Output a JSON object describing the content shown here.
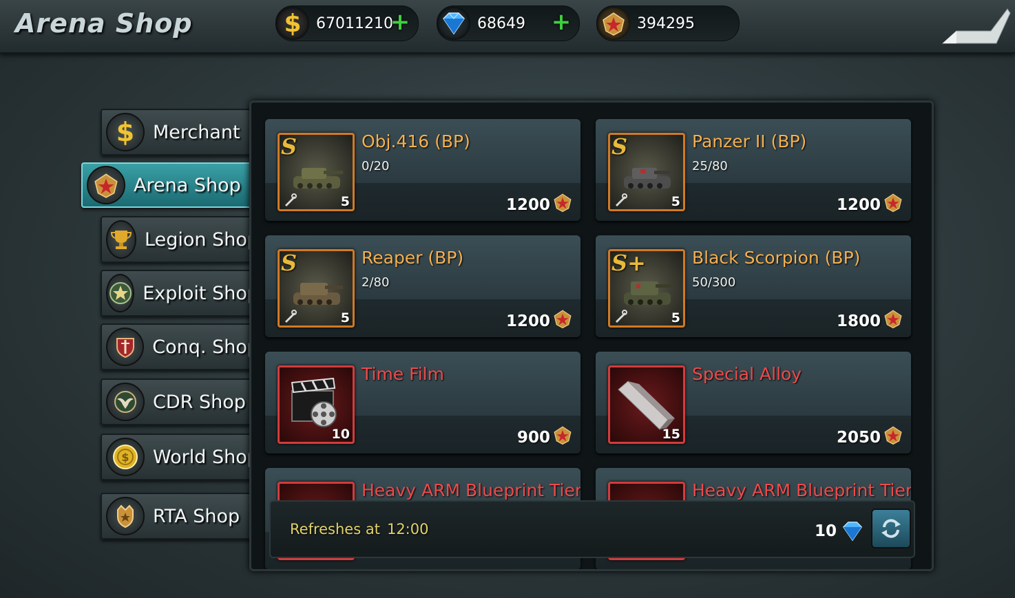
{
  "header": {
    "title": "Arena Shop",
    "gold": "67011210",
    "gems": "68649",
    "arena_points": "394295"
  },
  "sidebar": {
    "items": [
      {
        "label": "Merchant",
        "icon": "dollar-icon"
      },
      {
        "label": "Arena Shop",
        "icon": "arena-emblem-icon",
        "active": true
      },
      {
        "label": "Legion Shop",
        "icon": "trophy-icon"
      },
      {
        "label": "Exploit Shop",
        "icon": "star-shield-icon"
      },
      {
        "label": "Conq. Shop",
        "icon": "sword-shield-icon"
      },
      {
        "label": "CDR Shop",
        "icon": "eagle-icon"
      },
      {
        "label": "World Shop",
        "icon": "coin-icon"
      },
      {
        "label": "RTA Shop",
        "icon": "crown-shield-icon"
      }
    ]
  },
  "items": [
    {
      "name": "Obj.416 (BP)",
      "progress": "0/20",
      "price": "1200",
      "qty": "5",
      "badge": "S",
      "kind": "tank"
    },
    {
      "name": "Panzer II  (BP)",
      "progress": "25/80",
      "price": "1200",
      "qty": "5",
      "badge": "S",
      "kind": "tank"
    },
    {
      "name": "Reaper (BP)",
      "progress": "2/80",
      "price": "1200",
      "qty": "5",
      "badge": "S",
      "kind": "tank"
    },
    {
      "name": "Black Scorpion (BP)",
      "progress": "50/300",
      "price": "1800",
      "qty": "5",
      "badge": "S+",
      "kind": "tank"
    },
    {
      "name": "Time Film",
      "progress": "",
      "price": "900",
      "qty": "10",
      "badge": "",
      "kind": "film"
    },
    {
      "name": "Special Alloy",
      "progress": "",
      "price": "2050",
      "qty": "15",
      "badge": "",
      "kind": "alloy"
    },
    {
      "name": "Heavy ARM Blueprint Tier...",
      "progress": "",
      "price": "",
      "qty": "",
      "badge": "",
      "kind": "blueprint"
    },
    {
      "name": "Heavy ARM Blueprint Tier...",
      "progress": "",
      "price": "",
      "qty": "",
      "badge": "",
      "kind": "blueprint"
    }
  ],
  "footer": {
    "refresh_label": "Refreshes at",
    "refresh_time": "12:00",
    "refresh_cost": "10"
  }
}
